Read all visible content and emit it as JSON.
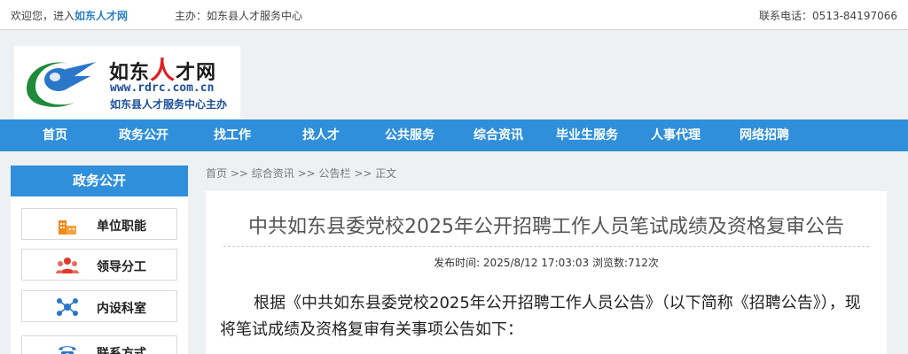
{
  "topbar": {
    "welcome_prefix": "欢迎您，进入",
    "site_name": "如东人才网",
    "host_label": "主办：如东县人才服务中心",
    "phone": "联系电话：0513-84197066"
  },
  "logo": {
    "title_a": "如东",
    "title_b": "人",
    "title_c": "才网",
    "url": "www.rdrc.com.cn",
    "subtitle": "如东县人才服务中心主办",
    "colors": {
      "blue": "#2a76c9",
      "green": "#1f8b3a",
      "red": "#e02020"
    }
  },
  "nav": {
    "items": [
      "首页",
      "政务公开",
      "找工作",
      "找人才",
      "公共服务",
      "综合资讯",
      "毕业生服务",
      "人事代理",
      "网络招聘"
    ]
  },
  "sidebar": {
    "title": "政务公开",
    "items": [
      {
        "label": "单位职能",
        "icon": "building-icon"
      },
      {
        "label": "领导分工",
        "icon": "people-icon"
      },
      {
        "label": "内设科室",
        "icon": "org-chart-icon"
      },
      {
        "label": "联系方式",
        "icon": "phone-icon"
      }
    ]
  },
  "breadcrumb": {
    "home": "首页",
    "sep": " >> ",
    "level1": "综合资讯",
    "level2": "公告栏",
    "level3": "正文"
  },
  "article": {
    "title": "中共如东县委党校2025年公开招聘工作人员笔试成绩及资格复审公告",
    "meta": "发布时间:  2025/8/12 17:03:03 浏览数:712次",
    "body": "根据《中共如东县委党校2025年公开招聘工作人员公告》（以下简称《招聘公告》），现将笔试成绩及资格复审有关事项公告如下："
  },
  "theme": {
    "primary": "#2f8fda",
    "accent": "#2a7fc6"
  }
}
